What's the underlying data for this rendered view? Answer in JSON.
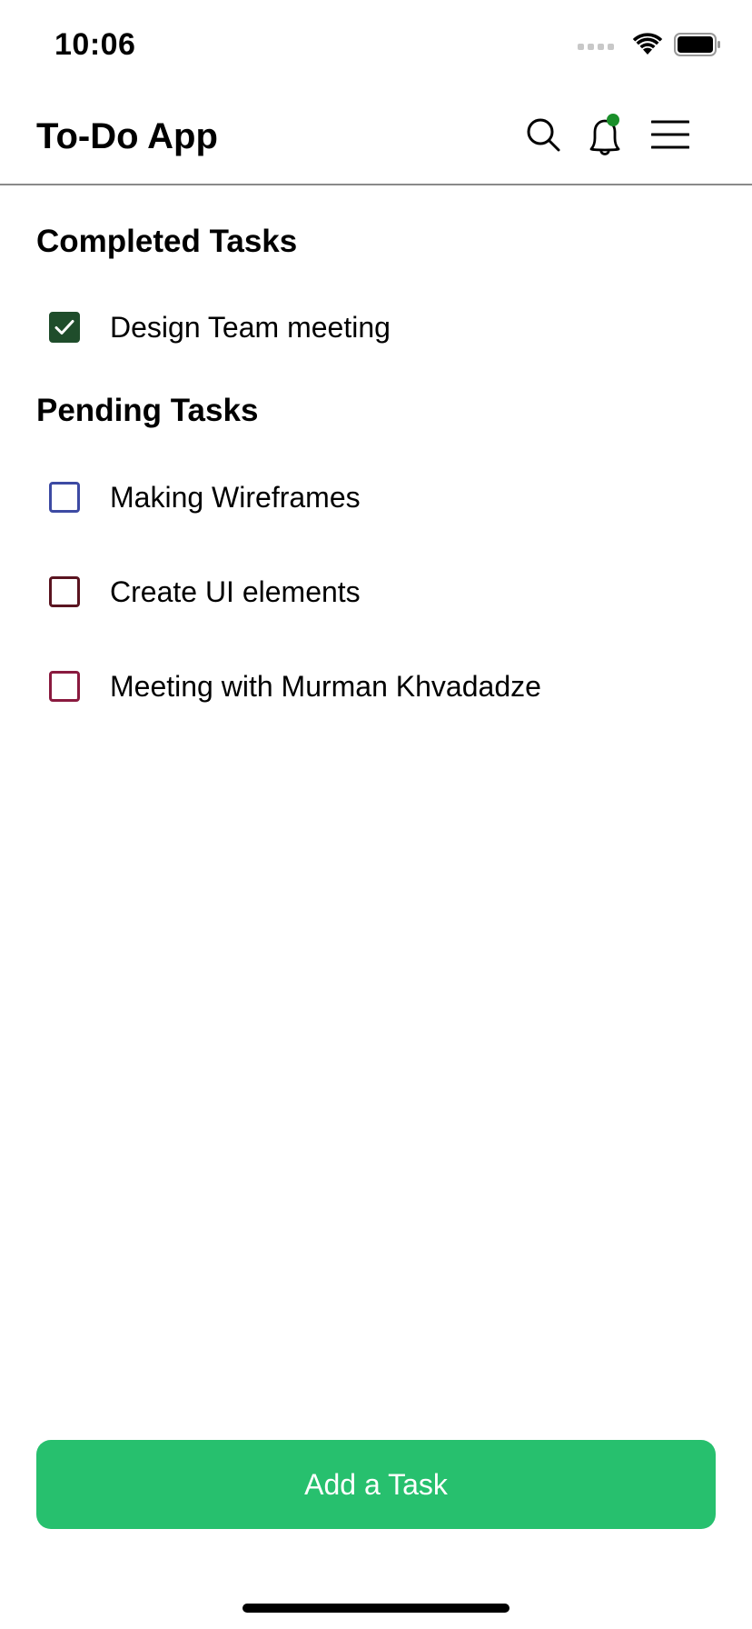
{
  "status_bar": {
    "time": "10:06"
  },
  "header": {
    "title": "To-Do App",
    "notification_dot_color": "#1a8f2a"
  },
  "sections": {
    "completed": {
      "title": "Completed Tasks",
      "tasks": [
        {
          "label": "Design Team meeting",
          "checked": true,
          "color": "#1f4d2b"
        }
      ]
    },
    "pending": {
      "title": "Pending Tasks",
      "tasks": [
        {
          "label": "Making Wireframes",
          "checked": false,
          "color": "#3d4aa3"
        },
        {
          "label": "Create UI elements",
          "checked": false,
          "color": "#5a1420"
        },
        {
          "label": "Meeting with Murman Khvadadze",
          "checked": false,
          "color": "#8a1a3f"
        }
      ]
    }
  },
  "actions": {
    "add_task_label": "Add a Task",
    "add_task_color": "#27c06e"
  }
}
